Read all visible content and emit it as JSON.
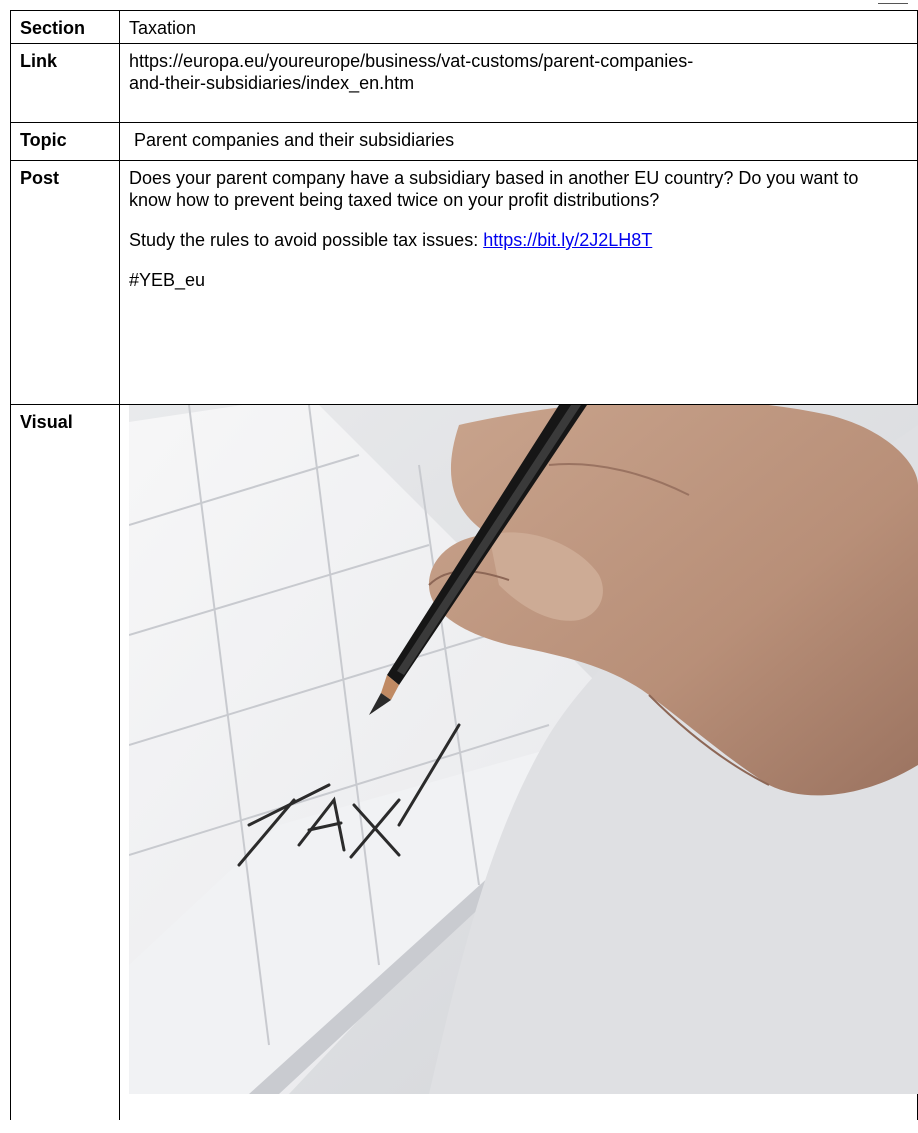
{
  "rows": {
    "section": {
      "label": "Section",
      "value": "Taxation"
    },
    "link": {
      "label": "Link",
      "value": "https://europa.eu/youreurope/business/vat-customs/parent-companies-and-their-subsidiaries/index_en.htm",
      "line1": "https://europa.eu/youreurope/business/vat-customs/parent-companies-",
      "line2": "and-their-subsidiaries/index_en.htm"
    },
    "topic": {
      "label": "Topic",
      "value": "Parent companies and their subsidiaries"
    },
    "post": {
      "label": "Post",
      "paragraph1": "Does your parent company have a subsidiary based in another EU country? Do you want to know how to prevent being taxed twice on your profit distributions?",
      "paragraph2_prefix": "Study the rules to avoid possible tax issues: ",
      "paragraph2_link": "https://bit.ly/2J2LH8T",
      "hashtag": "#YEB_eu"
    },
    "visual": {
      "label": "Visual",
      "image_text": "TAX"
    }
  },
  "colors": {
    "link": "#0000ee",
    "border": "#000000"
  }
}
